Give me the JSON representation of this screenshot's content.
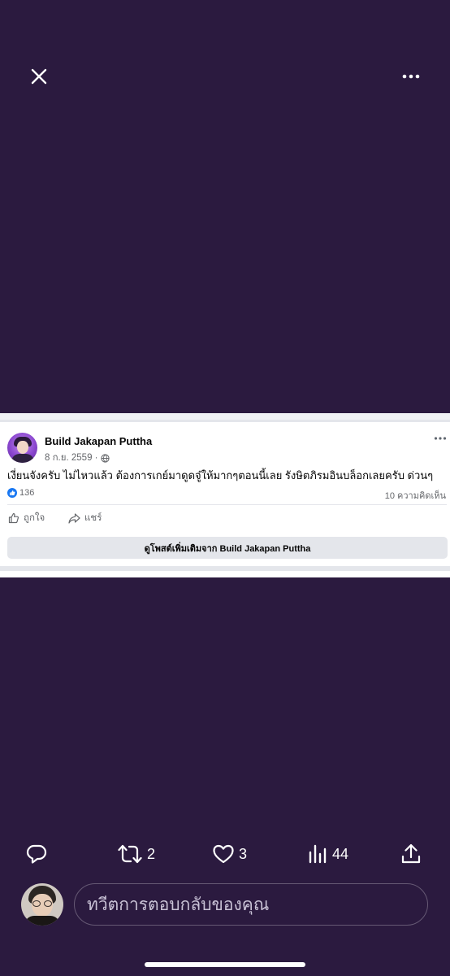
{
  "colors": {
    "background": "#2b1a3f",
    "foreground_icons": "#ffffff",
    "fb_text": "#050505",
    "fb_secondary": "#65676b",
    "fb_divider": "#e4e6eb",
    "fb_like_blue": "#1877f2"
  },
  "topbar": {
    "close_icon": "close-icon",
    "more_icon": "more-horizontal-icon"
  },
  "fb_post": {
    "author": "Build Jakapan Puttha",
    "date": "8 ก.ย. 2559 ·",
    "privacy_icon": "globe-icon",
    "text": "เงี่ยนจังครับ ไม่ไหวแล้ว ต้องการเกย์มาดูดจู๋ให้มากๆตอนนี้เลย รังษิตภิรมอินบล็อกเลยครับ ด่วนๆ",
    "reactions_count": "136",
    "comments_label": "10 ความคิดเห็น",
    "like_label": "ถูกใจ",
    "share_label": "แชร์",
    "see_more_label": "ดูโพสต์เพิ่มเติมจาก Build Jakapan Puttha"
  },
  "actions": {
    "reply_icon": "reply-icon",
    "retweet_icon": "retweet-icon",
    "retweet_count": "2",
    "like_icon": "heart-icon",
    "like_count": "3",
    "views_icon": "views-icon",
    "views_count": "44",
    "share_icon": "share-icon"
  },
  "reply": {
    "placeholder": "ทวีตการตอบกลับของคุณ"
  }
}
